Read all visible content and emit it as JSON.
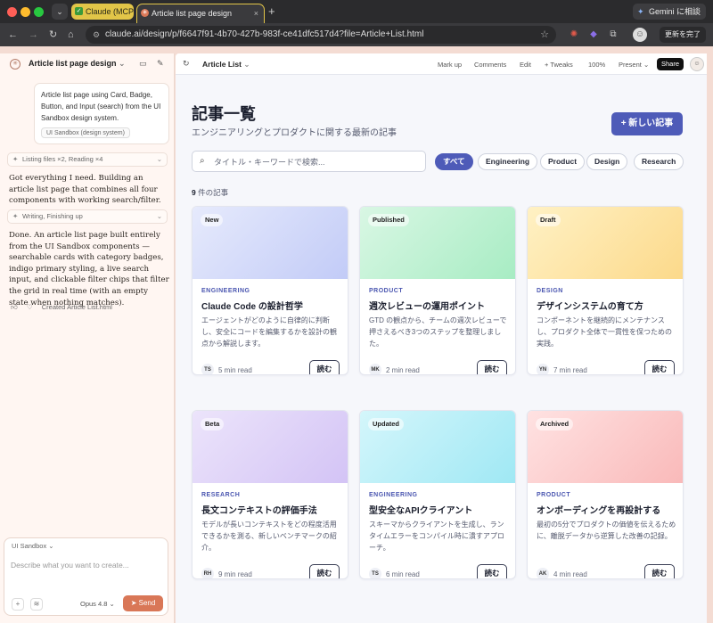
{
  "browser": {
    "tabs": [
      {
        "label": "Claude (MCP)",
        "icon": "check-icon"
      },
      {
        "label": "Article list page design",
        "icon": "claude-icon"
      }
    ],
    "url": "claude.ai/design/p/f6647f91-4b70-427b-983f-ce41dfc517d4?file=Article+List.html",
    "gemini_label": "Gemini に相談",
    "update_label": "更新を完了"
  },
  "chat": {
    "title": "Article list page design",
    "user_message": "Article list page using Card, Badge, Button, and Input (search) from the UI Sandbox design system.",
    "user_chip": "UI Sandbox (design system)",
    "tool1": "Listing files ×2, Reading ×4",
    "msg1": "Got everything I need. Building an article list page that combines all four components with working search/filter.",
    "tool2": "Writing, Finishing up",
    "msg2": "Done. An article list page built entirely from the UI Sandbox components — searchable cards with category badges, indigo primary styling, a live search input, and clickable filter chips that filter the grid in real time (with an empty state when nothing matches).",
    "created": "Created Article List.html",
    "composer_mode": "UI Sandbox",
    "composer_placeholder": "Describe what you want to create...",
    "model": "Opus 4.8",
    "send": "Send"
  },
  "artifact": {
    "file": "Article List",
    "menu": [
      "Mark up",
      "Comments",
      "Edit",
      "+ Tweaks",
      "100%",
      "Present"
    ],
    "share": "Share"
  },
  "page": {
    "title": "記事一覧",
    "subtitle": "エンジニアリングとプロダクトに関する最新の記事",
    "new_button": "+ 新しい記事",
    "search_placeholder": "タイトル・キーワードで検索...",
    "filters": [
      "すべて",
      "Engineering",
      "Product",
      "Design",
      "Research"
    ],
    "active_filter": "すべて",
    "count_num": "9",
    "count_suffix": " 件の記事",
    "read_label": "読む",
    "cards": [
      {
        "badge": "New",
        "category": "ENGINEERING",
        "title": "Claude Code の設計哲学",
        "desc": "エージェントがどのように自律的に判断し、安全にコードを編集するかを設計の観点から解説します。",
        "initials": "TS",
        "read": "5 min read",
        "cover_from": "#e6eafc",
        "cover_to": "#c2cbf7"
      },
      {
        "badge": "Published",
        "category": "PRODUCT",
        "title": "週次レビューの運用ポイント",
        "desc": "GTD の観点から、チームの週次レビューで押さえるべき3つのステップを整理しました。",
        "initials": "MK",
        "read": "2 min read",
        "cover_from": "#d9f7e4",
        "cover_to": "#a7ecc3"
      },
      {
        "badge": "Draft",
        "category": "DESIGN",
        "title": "デザインシステムの育て方",
        "desc": "コンポーネントを継続的にメンテナンスし、プロダクト全体で一貫性を保つための実践。",
        "initials": "YN",
        "read": "7 min read",
        "cover_from": "#fff1c4",
        "cover_to": "#fcd98a"
      },
      {
        "badge": "Beta",
        "category": "RESEARCH",
        "title": "長文コンテキストの評価手法",
        "desc": "モデルが長いコンテキストをどの程度活用できるかを測る、新しいベンチマークの紹介。",
        "initials": "RH",
        "read": "9 min read",
        "cover_from": "#ece4fb",
        "cover_to": "#d3c3f5"
      },
      {
        "badge": "Updated",
        "category": "ENGINEERING",
        "title": "型安全なAPIクライアント",
        "desc": "スキーマからクライアントを生成し、ランタイムエラーをコンパイル時に潰すアプローチ。",
        "initials": "TS",
        "read": "6 min read",
        "cover_from": "#d4f6fb",
        "cover_to": "#9fe8f4"
      },
      {
        "badge": "Archived",
        "category": "PRODUCT",
        "title": "オンボーディングを再設計する",
        "desc": "最初の5分でプロダクトの価値を伝えるために、離脱データから逆算した改善の記録。",
        "initials": "AK",
        "read": "4 min read",
        "cover_from": "#ffe2e2",
        "cover_to": "#f9b9b9"
      }
    ]
  },
  "colors": {
    "primary": "#4e5bb8",
    "accent": "#d97757"
  }
}
